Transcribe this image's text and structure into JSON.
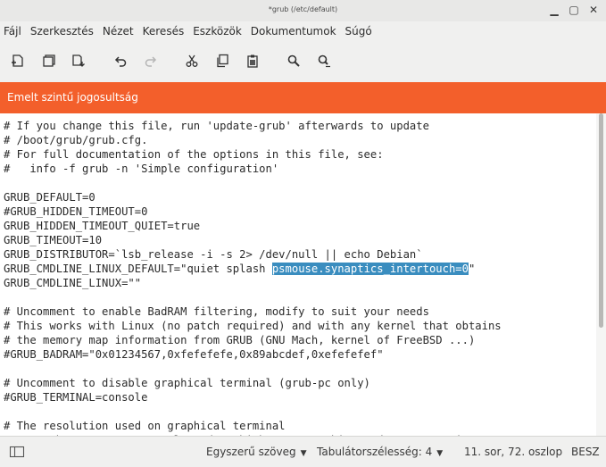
{
  "window": {
    "title": "*grub (/etc/default)",
    "minimize_glyph": "▁",
    "maximize_glyph": "▢",
    "close_glyph": "✕"
  },
  "menu": [
    "Fájl",
    "Szerkesztés",
    "Nézet",
    "Keresés",
    "Eszközök",
    "Dokumentumok",
    "Súgó"
  ],
  "toolbar": {
    "icons": [
      "new-document-icon",
      "open-document-icon",
      "save-document-icon",
      "undo-icon",
      "redo-icon",
      "cut-icon",
      "copy-icon",
      "paste-icon",
      "find-icon",
      "find-replace-icon"
    ]
  },
  "infobar": {
    "text": "Emelt szintű jogosultság",
    "color": "#f35f2b"
  },
  "editor": {
    "lines": [
      "# If you change this file, run 'update-grub' afterwards to update",
      "# /boot/grub/grub.cfg.",
      "# For full documentation of the options in this file, see:",
      "#   info -f grub -n 'Simple configuration'",
      "",
      "GRUB_DEFAULT=0",
      "#GRUB_HIDDEN_TIMEOUT=0",
      "GRUB_HIDDEN_TIMEOUT_QUIET=true",
      "GRUB_TIMEOUT=10",
      "GRUB_DISTRIBUTOR=`lsb_release -i -s 2> /dev/null || echo Debian`",
      "GRUB_CMDLINE_LINUX_DEFAULT=\"quiet splash psmouse.synaptics_intertouch=0\"",
      "GRUB_CMDLINE_LINUX=\"\"",
      "",
      "# Uncomment to enable BadRAM filtering, modify to suit your needs",
      "# This works with Linux (no patch required) and with any kernel that obtains",
      "# the memory map information from GRUB (GNU Mach, kernel of FreeBSD ...)",
      "#GRUB_BADRAM=\"0x01234567,0xfefefefe,0x89abcdef,0xefefefef\"",
      "",
      "# Uncomment to disable graphical terminal (grub-pc only)",
      "#GRUB_TERMINAL=console",
      "",
      "# The resolution used on graphical terminal",
      "# note that you can use only modes which your graphic card supports via VBE"
    ],
    "selected_line_index": 10,
    "selection": {
      "before": "GRUB_CMDLINE_LINUX_DEFAULT=\"quiet splash ",
      "selected": "psmouse.synaptics_intertouch=0",
      "after": "\""
    },
    "selection_color": "#3a8dbf"
  },
  "statusbar": {
    "syntax": "Egyszerű szöveg",
    "tab_width": "Tabulátorszélesség: 4",
    "position": "11. sor, 72. oszlop",
    "mode": "BESZ",
    "dropdown_glyph": "▼"
  }
}
